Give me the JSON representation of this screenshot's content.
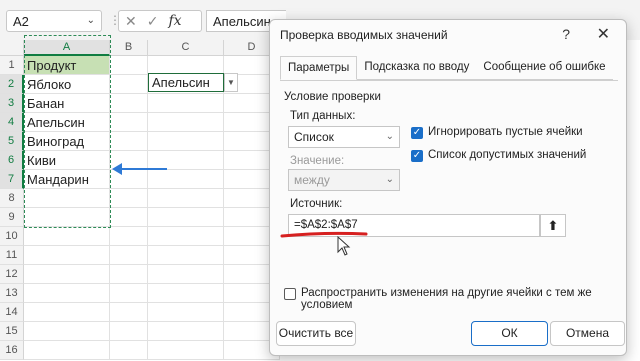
{
  "formula_bar": {
    "name_box": "A2",
    "formula_value": "Апельсин",
    "fx": "fx",
    "dots": "⋮"
  },
  "sheet": {
    "columns": [
      "A",
      "B",
      "C",
      "D"
    ],
    "rows": [
      "1",
      "2",
      "3",
      "4",
      "5",
      "6",
      "7",
      "8",
      "9",
      "10",
      "11",
      "12",
      "13",
      "14",
      "15",
      "16"
    ],
    "column_a": [
      "Продукт",
      "Яблоко",
      "Банан",
      "Апельсин",
      "Виноград",
      "Киви",
      "Мандарин"
    ],
    "dropdown_cell_value": "Апельсин"
  },
  "dialog": {
    "title": "Проверка вводимых значений",
    "help": "?",
    "close": "✕",
    "tabs": [
      "Параметры",
      "Подсказка по вводу",
      "Сообщение об ошибке"
    ],
    "section_title": "Условие проверки",
    "data_type_label": "Тип данных:",
    "data_type_value": "Список",
    "ignore_blank_label": "Игнорировать пустые ячейки",
    "in_cell_dropdown_label": "Список допустимых значений",
    "value_label": "Значение:",
    "value_value": "между",
    "source_label": "Источник:",
    "source_value": "=$A$2:$A$7",
    "apply_all_label": "Распространить изменения на другие ячейки с тем же условием",
    "clear_all_label": "Очистить все",
    "ok_label": "ОК",
    "cancel_label": "Отмена"
  },
  "colors": {
    "excel_green": "#107c41",
    "header_fill": "#c7e0b4",
    "accent_blue": "#1a6ec8",
    "annotation_red": "#d62020",
    "arrow_blue": "#2f7ad6"
  }
}
